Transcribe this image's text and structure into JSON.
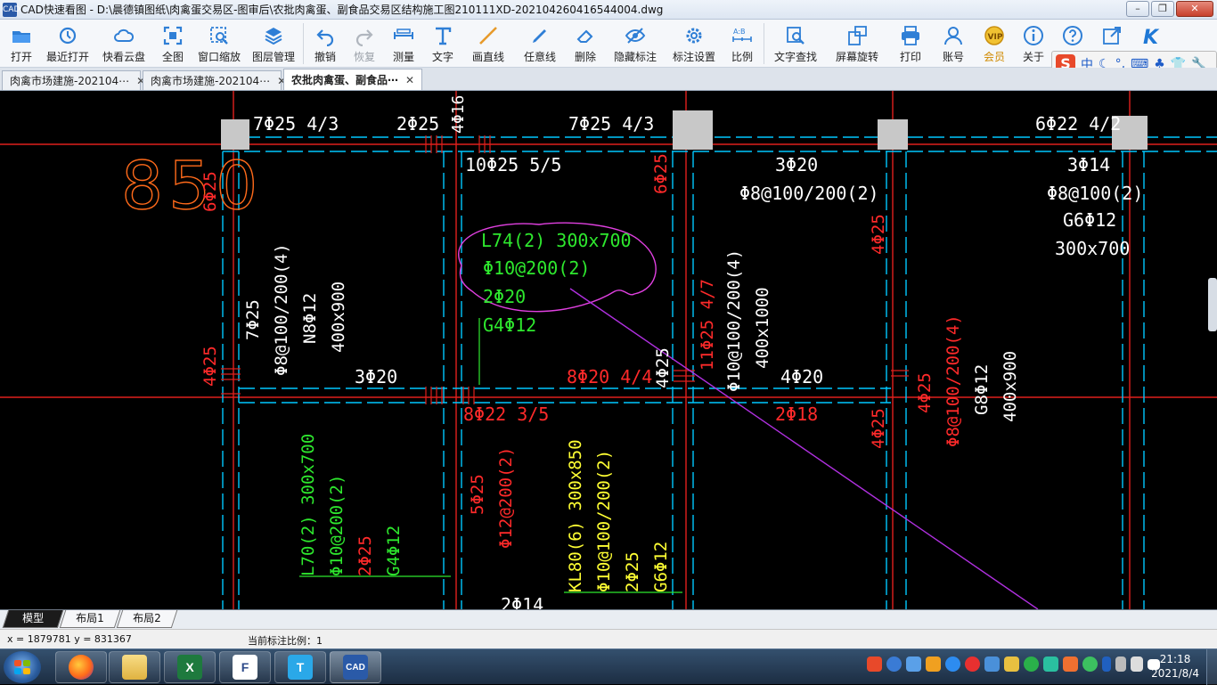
{
  "window": {
    "app_icon_text": "CAD",
    "title": "CAD快速看图 - D:\\晨德镇图纸\\肉禽蛋交易区-图审后\\农批肉禽蛋、副食品交易区结构施工图210111XD-202104260416544004.dwg",
    "min": "–",
    "max": "❐",
    "close": "✕"
  },
  "toolbar": {
    "items": [
      {
        "label": "打开"
      },
      {
        "label": "最近打开"
      },
      {
        "label": "快看云盘"
      },
      {
        "label": "全图"
      },
      {
        "label": "窗口缩放"
      },
      {
        "label": "图层管理"
      },
      {
        "label": "撤销"
      },
      {
        "label": "恢复"
      },
      {
        "label": "测量"
      },
      {
        "label": "文字"
      },
      {
        "label": "画直线"
      },
      {
        "label": "任意线"
      },
      {
        "label": "删除"
      },
      {
        "label": "隐藏标注"
      },
      {
        "label": "标注设置"
      },
      {
        "label": "比例"
      },
      {
        "label": "文字查找"
      },
      {
        "label": "屏幕旋转"
      },
      {
        "label": "打印"
      },
      {
        "label": "账号"
      },
      {
        "label": "会员"
      },
      {
        "label": "关于"
      },
      {
        "label": "帮助"
      },
      {
        "label": "导出"
      },
      {
        "label": "K"
      }
    ]
  },
  "ime": {
    "logo": "S",
    "mode": "中"
  },
  "tabs": [
    {
      "label": "肉禽市场建施-202104⋯",
      "close": "✕"
    },
    {
      "label": "肉禽市场建施-202104⋯",
      "close": "✕"
    },
    {
      "label": "农批肉禽蛋、副食品⋯",
      "close": "✕"
    }
  ],
  "drawing": {
    "big_number": "850",
    "labels": {
      "t01": "7Φ25 4/3",
      "t02": "2Φ25",
      "t03": "4Φ16",
      "t04": "7Φ25 4/3",
      "t05": "6Φ22 4/2",
      "t06": "10Φ25 5/5",
      "t07": "3Φ20",
      "t08": "Φ8@100/200(2)",
      "t09": "3Φ14",
      "t10": "Φ8@100(2)",
      "t11": "G6Φ12",
      "t12": "300x700",
      "g1": "L74(2) 300x700",
      "g2": "Φ10@200(2)",
      "g3": "2Φ20",
      "g4": "G4Φ12",
      "v01": "7Φ25",
      "v02": "Φ8@100/200(4)",
      "v03": "N8Φ12",
      "v04": "400x900",
      "v05": "4Φ25",
      "v06": "6Φ25",
      "v07": "6Φ25",
      "v08": "4Φ25",
      "v09": "11Φ25 4/7",
      "v10": "Φ10@100/200(4)",
      "v11": "400x1000",
      "m01": "3Φ20",
      "m02": "8Φ20 4/4",
      "m03": "4Φ25",
      "m04": "4Φ20",
      "m05": "8Φ22 3/5",
      "m06": "2Φ18",
      "r01": "4Φ25",
      "r02": "Φ8@100/200(4)",
      "r03": "G8Φ12",
      "r04": "400x900",
      "r05": "4Φ25",
      "b01": "L70(2) 300x700",
      "b02": "Φ10@200(2)",
      "b03": "2Φ25",
      "b04": "G4Φ12",
      "b05": "5Φ25",
      "b06": "Φ12@200(2)",
      "b07": "KL80(6) 300x850",
      "b08": "Φ10@100/200(2)",
      "b09": "2Φ25",
      "b10": "G6Φ12",
      "b11": "2Φ14"
    }
  },
  "layout_tabs": [
    {
      "label": "模型"
    },
    {
      "label": "布局1"
    },
    {
      "label": "布局2"
    }
  ],
  "status": {
    "coords": "x = 1879781 y = 831367",
    "scale": "当前标注比例：1"
  },
  "taskbar": {
    "apps": [
      {
        "name": "firefox"
      },
      {
        "name": "explorer"
      },
      {
        "name": "excel",
        "text": "X"
      },
      {
        "name": "app-f",
        "text": "F"
      },
      {
        "name": "app-t",
        "text": "T"
      },
      {
        "name": "cad",
        "text": "CAD"
      }
    ],
    "time": "21:18",
    "date": "2021/8/4"
  },
  "colors": {
    "canvas": "#000000",
    "axis_red": "#e0201c",
    "beam_cyan": "#00c8ff",
    "text_green": "#2ee82e",
    "text_red": "#ff2a2a",
    "text_yellow": "#ffff33",
    "text_white": "#ffffff",
    "magenta": "#e040e0",
    "orange": "#ff6a1a"
  }
}
